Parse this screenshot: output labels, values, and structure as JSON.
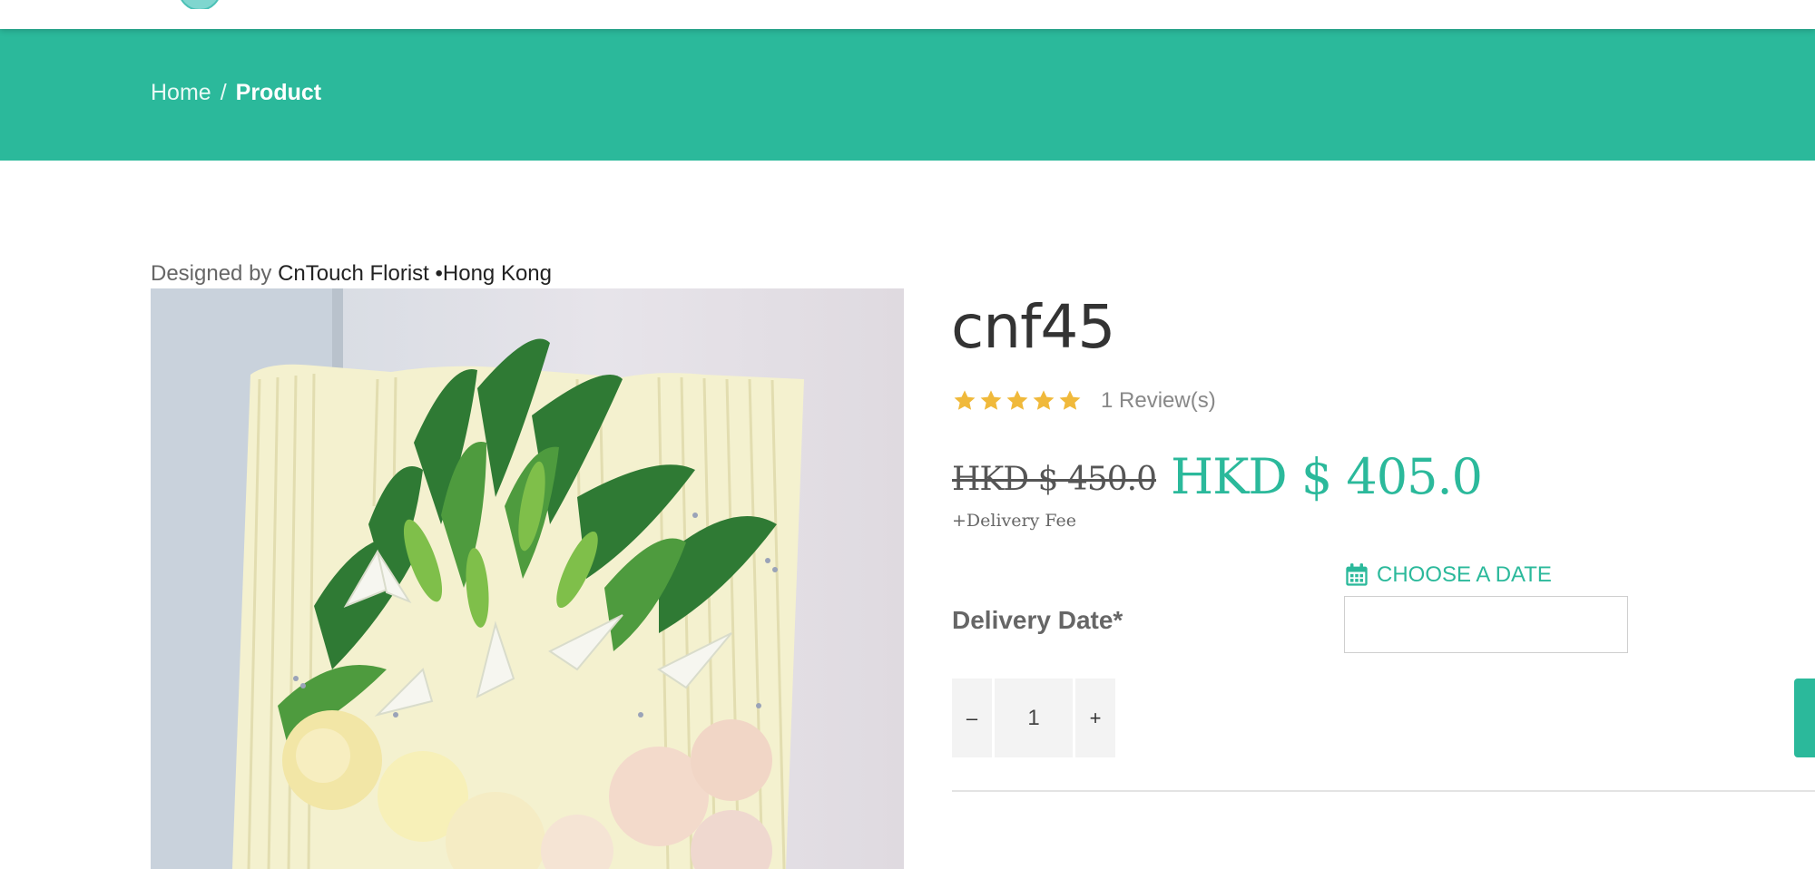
{
  "header": {
    "logo_icon": "logo-emblem"
  },
  "breadcrumb": {
    "home": "Home",
    "separator": "/",
    "current": "Product"
  },
  "designer": {
    "prefix": "Designed by",
    "shop": "CnTouch Florist",
    "location": "•Hong Kong"
  },
  "product": {
    "image_alt": "flower-bouquet-image",
    "title": "cnf45",
    "rating": {
      "stars": 5,
      "max": 5,
      "reviews_label": "1 Review(s)"
    },
    "old_price": "HKD $ 450.0",
    "price": "HKD $ 405.0",
    "delivery_fee_note": "+Delivery Fee",
    "delivery": {
      "choose_date_label": "CHOOSE A DATE",
      "label": "Delivery Date*",
      "input_value": ""
    },
    "quantity": {
      "minus": "–",
      "value": "1",
      "plus": "+"
    }
  },
  "colors": {
    "accent": "#2bb99b",
    "star": "#f0b93b"
  }
}
